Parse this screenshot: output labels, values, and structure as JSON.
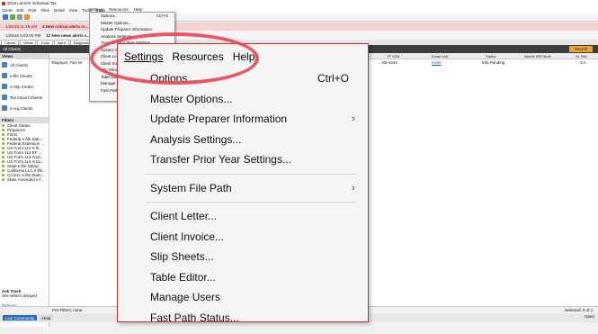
{
  "app": {
    "title": "2018 Lacerte Individual Tax",
    "menus": [
      "Client",
      "Edit",
      "Print",
      "Files",
      "Detail",
      "View",
      "Tools",
      "Input",
      "Settings",
      "Resources",
      "Help"
    ],
    "alerts": [
      {
        "time": "1/25/15 11:45 AM",
        "message": "4 New critical alerts re..."
      },
      {
        "time": "1/25/15 5:03:00 PM",
        "message": "12 New news alerts s..."
      }
    ],
    "tabs": [
      "Clients",
      "Detail",
      "Tools",
      "Input",
      "Diagnostics",
      "Analysis"
    ],
    "list_header": "All Clients",
    "search_label": "Search",
    "columns": [
      "TP SSN",
      "Email Link",
      "Status",
      "Needs KEP/Auth",
      "St. Ret."
    ],
    "row": {
      "name": "Taxpayer, Tom M",
      "ssn": "...-55-4444",
      "email": "Invite",
      "status": "Info Pending",
      "state": "CA"
    },
    "sidebar": {
      "views_title": "Views",
      "nav": [
        "All Clients",
        "e-file Clients",
        "e-Slip Center",
        "Tax Import Clients",
        "e-org Clients"
      ],
      "filters_title": "Filters",
      "filters": [
        "Client Status",
        "Preparers",
        "Firms",
        "Federal e-file Stat...",
        "Federal Extension ...",
        "US Form 114 e-fil...",
        "US Form 114 EF ...",
        "US Form 114 Amd...",
        "US Form 114 Amd...",
        "State e-file Status",
        "California LLC e-file...",
        "CA Ext. e-file Statu...",
        "State Amended e-f..."
      ],
      "ask_title": "Ask Track",
      "ask_sub": "See what's delayed",
      "ask_link": "Delayed Acknowledgements"
    },
    "status": {
      "left": "Pre-Filters: none",
      "right": "Selected: 0 of 1"
    },
    "bottom": {
      "live": "Live Community",
      "help": "Help",
      "open": "Open"
    }
  },
  "mini_menu": {
    "bar": [
      "Settings",
      "Resources",
      "Help"
    ],
    "items": [
      "Options...",
      "Master Options...",
      "Update Preparer Information",
      "Analysis Settings...",
      "Transfer Prior Year Settings...",
      "System File Path",
      "Client Letter...",
      "Client Invoice...",
      "Slip Sheets...",
      "Table Editor...",
      "Manage Users",
      "Fast Path Status..."
    ],
    "shortcut": "Ctrl+O"
  },
  "zoom_menu": {
    "bar": {
      "settings": "Settings",
      "resources": "Resources",
      "help": "Help"
    },
    "items": {
      "options": "Options...",
      "options_shortcut": "Ctrl+O",
      "master_options": "Master Options...",
      "update_preparer": "Update Preparer Information",
      "analysis_settings": "Analysis Settings...",
      "transfer_prior_year": "Transfer Prior Year Settings...",
      "system_file_path": "System File Path",
      "client_letter": "Client Letter...",
      "client_invoice": "Client Invoice...",
      "slip_sheets": "Slip Sheets...",
      "table_editor": "Table Editor...",
      "manage_users": "Manage Users",
      "fast_path_status": "Fast Path Status..."
    }
  },
  "colors": {
    "callout_border": "#d12e3a",
    "highlight_ellipse": "#e94553",
    "alert_bg": "#f6d2d2",
    "search_button": "#e9a13b"
  }
}
